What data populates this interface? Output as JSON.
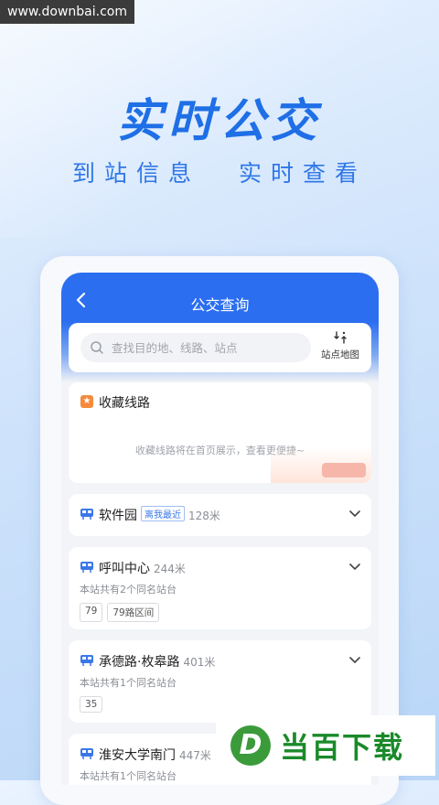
{
  "watermark_top": "www.downbai.com",
  "hero": {
    "title": "实时公交",
    "subtitle_left": "到站信息",
    "subtitle_right": "实时查看"
  },
  "app": {
    "title": "公交查询",
    "search_placeholder": "查找目的地、线路、站点",
    "map_label": "站点地图",
    "favorites": {
      "title": "收藏线路",
      "empty_text": "收藏线路将在首页展示，查看更便捷~"
    },
    "stops": [
      {
        "name": "软件园",
        "tag": "离我最近",
        "distance": "128米",
        "description": "",
        "lines": []
      },
      {
        "name": "呼叫中心",
        "tag": "",
        "distance": "244米",
        "description": "本站共有2个同名站台",
        "lines": [
          "79",
          "79路区间"
        ]
      },
      {
        "name": "承德路·枚皋路",
        "tag": "",
        "distance": "401米",
        "description": "本站共有1个同名站台",
        "lines": [
          "35"
        ]
      },
      {
        "name": "淮安大学南门",
        "tag": "",
        "distance": "447米",
        "description": "本站共有1个同名站台",
        "lines": []
      }
    ]
  },
  "brand_watermark": {
    "logo_letter": "D",
    "text": "当百下载"
  },
  "colors": {
    "primary": "#2b6ef0",
    "hero_text": "#1f6fe6",
    "accent_orange": "#f58a3c"
  }
}
